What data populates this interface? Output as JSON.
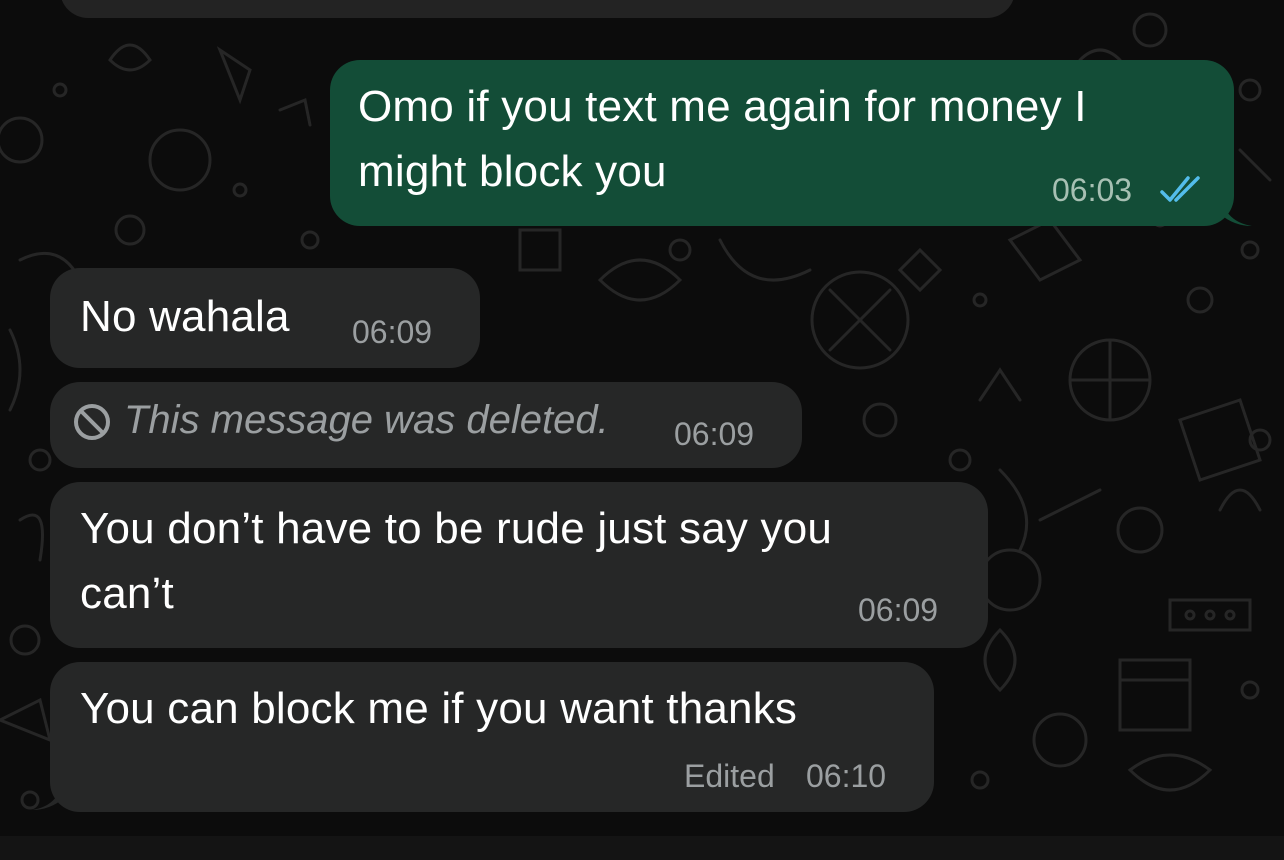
{
  "theme": {
    "background": "#0c0c0c",
    "incoming_bubble": "#262727",
    "outgoing_bubble": "#134d37",
    "read_receipt": "#53bdeb",
    "meta_text": "#9b9fa1"
  },
  "messages": [
    {
      "direction": "outgoing",
      "lines": [
        "Omo if you text me again for money I",
        "might block you"
      ],
      "time": "06:03",
      "status_icon": "double-check-read-icon"
    },
    {
      "direction": "incoming",
      "lines": [
        "No wahala"
      ],
      "time": "06:09"
    },
    {
      "direction": "incoming",
      "deleted": true,
      "text": "This message was deleted.",
      "time": "06:09",
      "icon": "prohibited-icon"
    },
    {
      "direction": "incoming",
      "lines": [
        "You don’t have to be rude just say you",
        "can’t"
      ],
      "time": "06:09"
    },
    {
      "direction": "incoming",
      "lines": [
        "You can block me if you want thanks"
      ],
      "edited_label": "Edited",
      "time": "06:10"
    }
  ]
}
